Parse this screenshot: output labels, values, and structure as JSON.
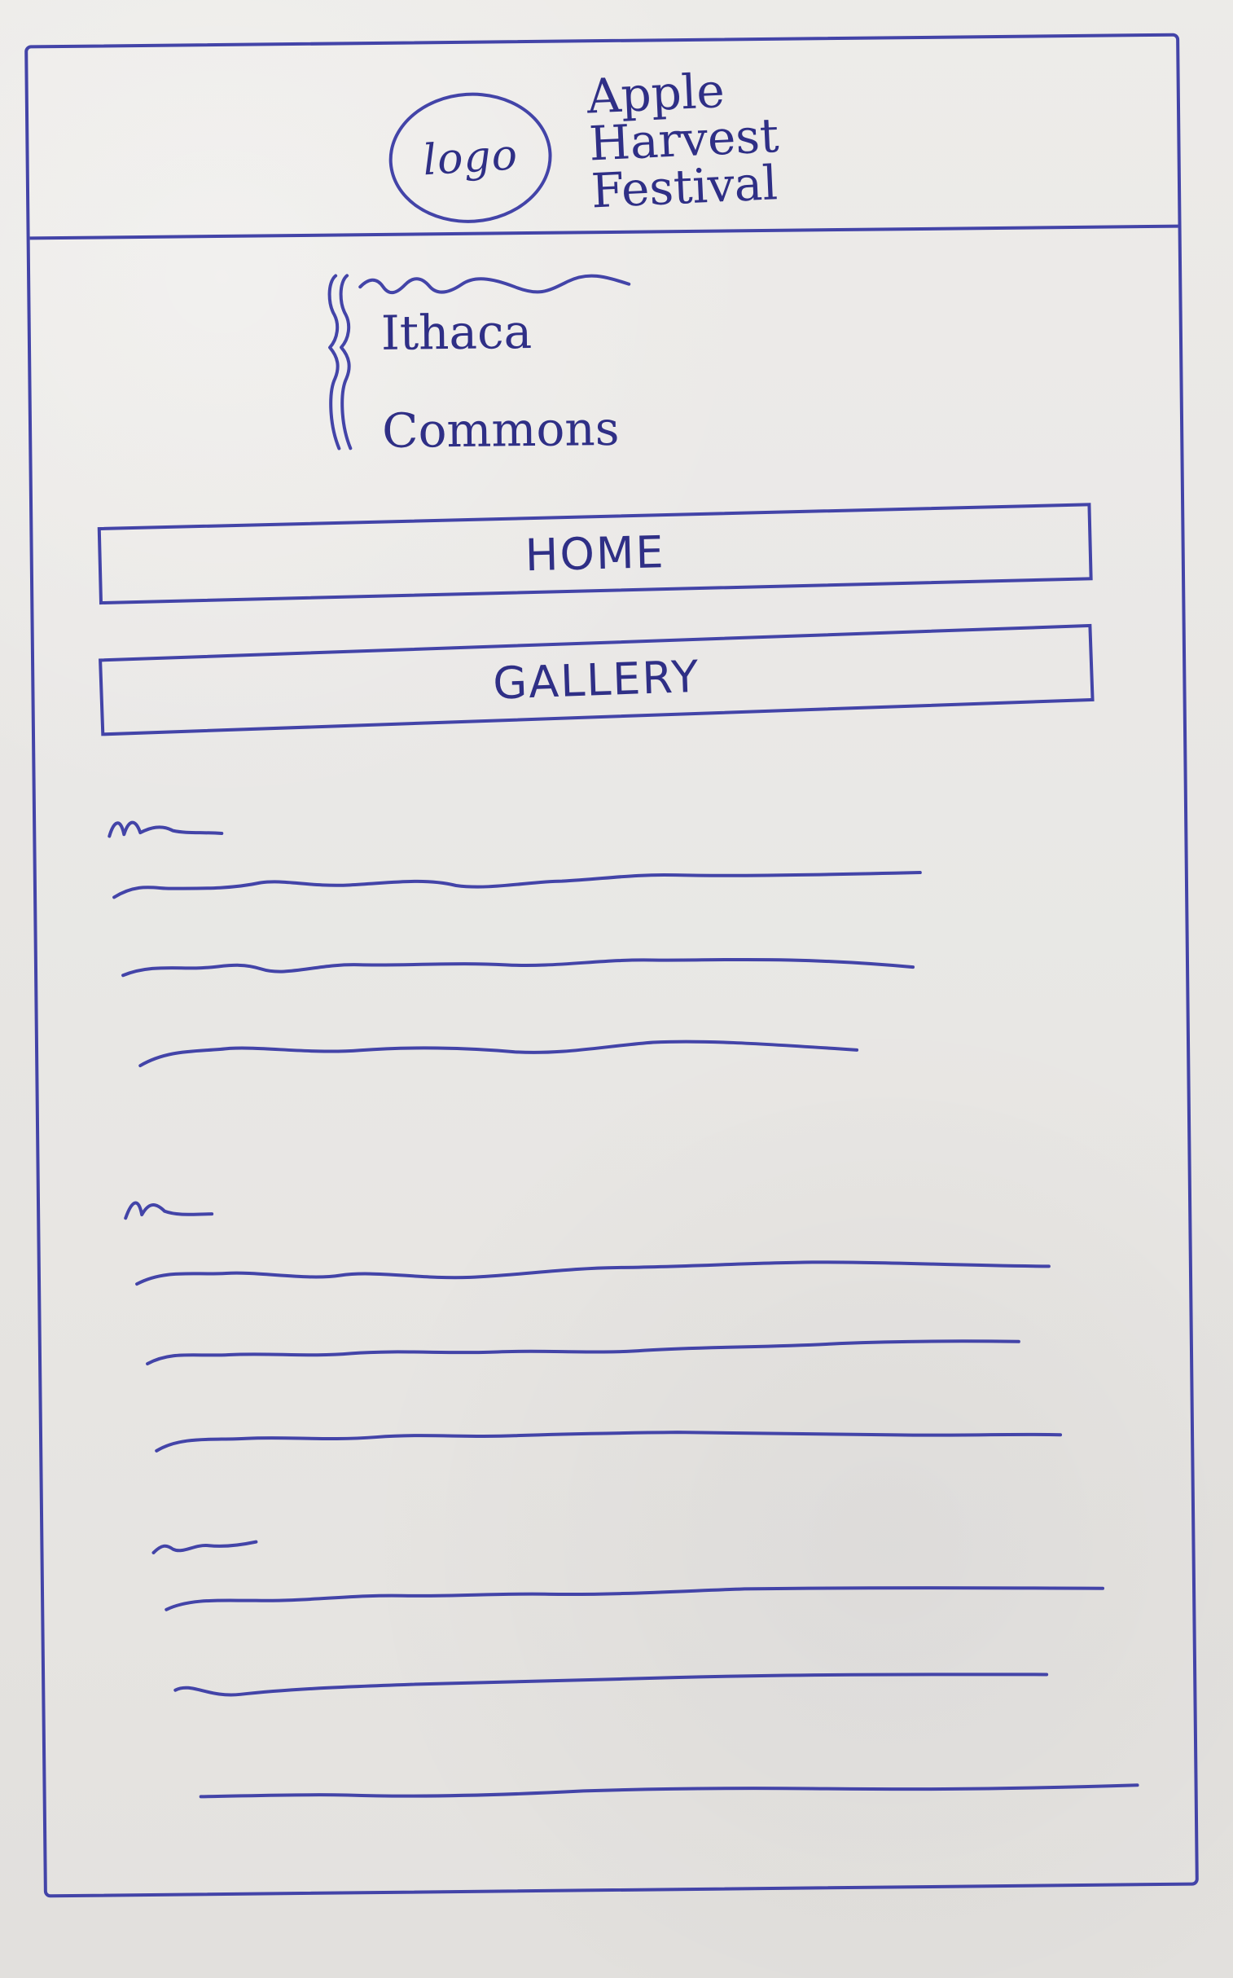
{
  "header": {
    "logo_label": "logo",
    "title_lines": [
      "Apple",
      "Harvest",
      "Festival"
    ]
  },
  "location": {
    "lines": [
      "Ithaca",
      "Commons"
    ]
  },
  "nav": {
    "home_label": "HOME",
    "gallery_label": "GALLERY"
  }
}
